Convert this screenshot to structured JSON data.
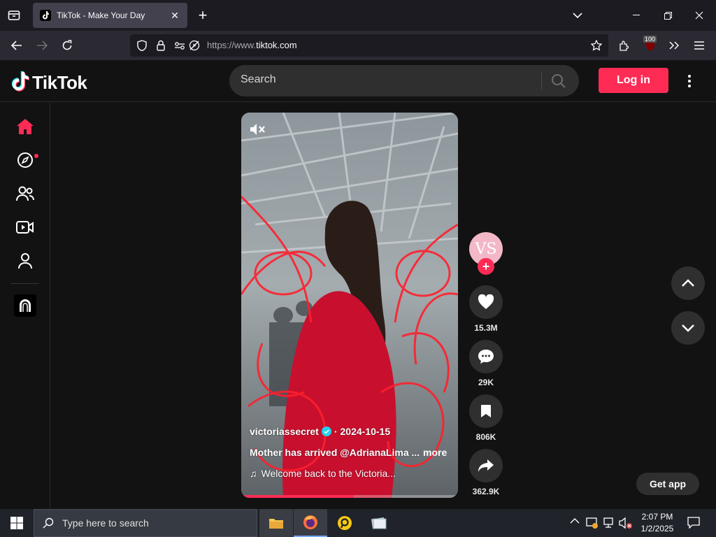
{
  "browser": {
    "tab_title": "TikTok - Make Your Day",
    "url_prefix": "https://www.",
    "url_domain": "tiktok.com",
    "ublock_count": "100"
  },
  "header": {
    "logo": "TikTok",
    "search_placeholder": "Search",
    "login_label": "Log in"
  },
  "sidebar": {
    "items": [
      {
        "icon": "home-icon"
      },
      {
        "icon": "explore-icon"
      },
      {
        "icon": "following-icon"
      },
      {
        "icon": "live-icon"
      },
      {
        "icon": "profile-icon"
      },
      {
        "icon": "app-icon"
      }
    ]
  },
  "video": {
    "username": "victoriassecret",
    "date": "2024-10-15",
    "description": "Mother has arrived @AdrianaLima  ...",
    "more": "more",
    "music": "Welcome back to the Victoria...",
    "progress": 0.52
  },
  "actions": {
    "avatar_text": "VS",
    "likes": "15.3M",
    "comments": "29K",
    "saves": "806K",
    "shares": "362.9K"
  },
  "get_app": "Get app",
  "taskbar": {
    "search_placeholder": "Type here to search",
    "time": "2:07 PM",
    "date": "1/2/2025"
  },
  "colors": {
    "accent": "#fe2c55",
    "background": "#121212"
  }
}
